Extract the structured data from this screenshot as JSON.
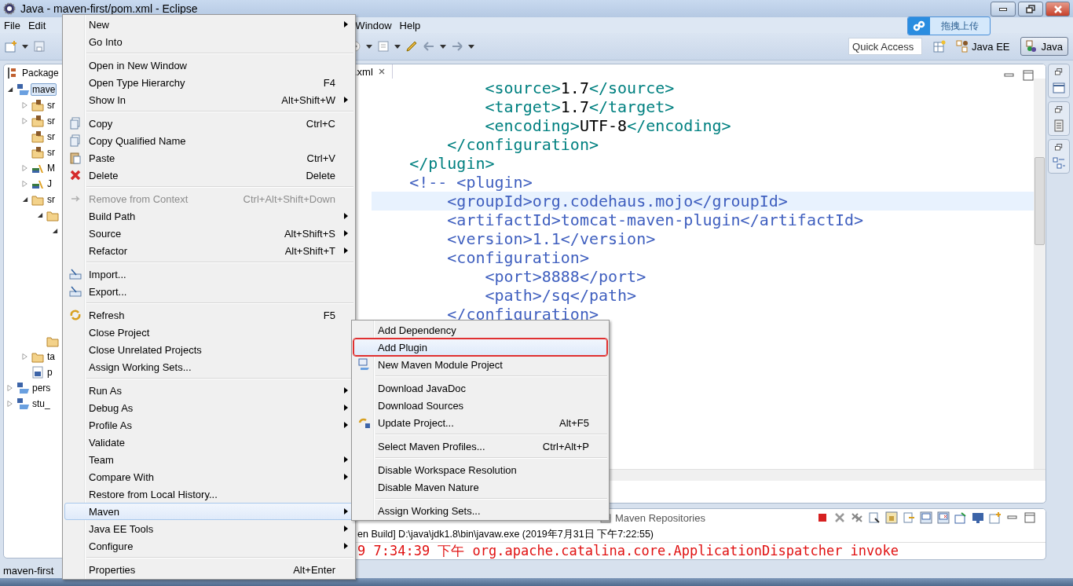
{
  "window": {
    "title": "Java - maven-first/pom.xml - Eclipse"
  },
  "menubar": [
    "File",
    "Edit",
    "Window",
    "Help"
  ],
  "quick_access": {
    "placeholder": "Quick Access"
  },
  "perspectives": [
    {
      "label": "Java EE",
      "selected": false
    },
    {
      "label": "Java",
      "selected": true
    }
  ],
  "upload_button": {
    "label": "拖拽上传"
  },
  "package_explorer": {
    "title": "Package",
    "tree": [
      {
        "label": "mave",
        "kind": "project",
        "expanded": true,
        "selected": true,
        "children": [
          {
            "label": "sr",
            "kind": "package",
            "expanded": false,
            "selected": false
          },
          {
            "label": "sr",
            "kind": "package",
            "expanded": false,
            "selected": false
          },
          {
            "label": "sr",
            "kind": "package",
            "selected": false
          },
          {
            "label": "sr",
            "kind": "package",
            "selected": false
          },
          {
            "label": "M",
            "kind": "library",
            "expanded": false,
            "selected": false
          },
          {
            "label": "J",
            "kind": "library",
            "expanded": false,
            "selected": false
          },
          {
            "label": "sr",
            "kind": "folder",
            "expanded": true,
            "selected": false,
            "children": [
              {
                "kind": "folder",
                "expanded": true,
                "children": [
                  {
                    "expanded": true
                  }
                ]
              },
              {
                "kind": "folder"
              }
            ]
          },
          {
            "label": "ta",
            "kind": "folder",
            "expanded": false,
            "selected": false
          },
          {
            "label": "p",
            "kind": "file",
            "selected": false
          }
        ]
      },
      {
        "label": "pers",
        "kind": "project",
        "expanded": false,
        "selected": false
      },
      {
        "label": "stu_",
        "kind": "project",
        "expanded": false,
        "selected": false
      }
    ]
  },
  "editor": {
    "tab": ".xml",
    "lines": [
      {
        "current": false,
        "segments": [
          {
            "kind": "markup",
            "text": "            <source>"
          },
          {
            "kind": "content",
            "text": "1.7"
          },
          {
            "kind": "markup",
            "text": "</source>"
          }
        ]
      },
      {
        "current": false,
        "segments": [
          {
            "kind": "markup",
            "text": "            <target>"
          },
          {
            "kind": "content",
            "text": "1.7"
          },
          {
            "kind": "markup",
            "text": "</target>"
          }
        ]
      },
      {
        "current": false,
        "segments": [
          {
            "kind": "markup",
            "text": "            <encoding>"
          },
          {
            "kind": "content",
            "text": "UTF-8"
          },
          {
            "kind": "markup",
            "text": "</encoding>"
          }
        ]
      },
      {
        "current": false,
        "segments": [
          {
            "kind": "markup",
            "text": "        </configuration>"
          }
        ]
      },
      {
        "current": false,
        "segments": [
          {
            "kind": "markup",
            "text": "    </plugin>"
          }
        ]
      },
      {
        "current": false,
        "segments": [
          {
            "kind": "comment",
            "text": "    <!-- <plugin>"
          }
        ]
      },
      {
        "current": true,
        "segments": [
          {
            "kind": "comment",
            "text": "        <groupId>org.codehaus.mojo</groupId>"
          }
        ]
      },
      {
        "current": false,
        "segments": [
          {
            "kind": "comment",
            "text": "        <artifactId>tomcat-maven-plugin</artifactId>"
          }
        ]
      },
      {
        "current": false,
        "segments": [
          {
            "kind": "comment",
            "text": "        <version>1.1</version>"
          }
        ]
      },
      {
        "current": false,
        "segments": [
          {
            "kind": "comment",
            "text": "        <configuration>"
          }
        ]
      },
      {
        "current": false,
        "segments": [
          {
            "kind": "comment",
            "text": "            <port>8888</port>"
          }
        ]
      },
      {
        "current": false,
        "segments": [
          {
            "kind": "comment",
            "text": "            <path>/sq</path>"
          }
        ]
      },
      {
        "current": false,
        "segments": [
          {
            "kind": "comment",
            "text": "        </configuration>"
          }
        ]
      }
    ]
  },
  "console": {
    "tab": "Maven Repositories",
    "lines": [
      {
        "kind": "info",
        "text": "en Build] D:\\java\\jdk1.8\\bin\\javaw.exe (2019年7月31日 下午7:22:55)"
      },
      {
        "kind": "error",
        "text": "9 7:34:39 下午 org.apache.catalina.core.ApplicationDispatcher invoke"
      }
    ]
  },
  "status_bar": {
    "text": "maven-first"
  },
  "context_menu": {
    "items": [
      {
        "kind": "item",
        "label": "New",
        "submenu": true
      },
      {
        "kind": "item",
        "label": "Go Into"
      },
      {
        "kind": "separator"
      },
      {
        "kind": "item",
        "label": "Open in New Window"
      },
      {
        "kind": "item",
        "label": "Open Type Hierarchy",
        "shortcut": "F4"
      },
      {
        "kind": "item",
        "label": "Show In",
        "shortcut": "Alt+Shift+W",
        "submenu": true
      },
      {
        "kind": "separator"
      },
      {
        "kind": "item",
        "label": "Copy",
        "shortcut": "Ctrl+C"
      },
      {
        "kind": "item",
        "label": "Copy Qualified Name"
      },
      {
        "kind": "item",
        "label": "Paste",
        "shortcut": "Ctrl+V"
      },
      {
        "kind": "item",
        "label": "Delete",
        "shortcut": "Delete"
      },
      {
        "kind": "separator"
      },
      {
        "kind": "item",
        "label": "Remove from Context",
        "shortcut": "Ctrl+Alt+Shift+Down",
        "disabled": true
      },
      {
        "kind": "item",
        "label": "Build Path",
        "submenu": true
      },
      {
        "kind": "item",
        "label": "Source",
        "shortcut": "Alt+Shift+S",
        "submenu": true
      },
      {
        "kind": "item",
        "label": "Refactor",
        "shortcut": "Alt+Shift+T",
        "submenu": true
      },
      {
        "kind": "separator"
      },
      {
        "kind": "item",
        "label": "Import..."
      },
      {
        "kind": "item",
        "label": "Export..."
      },
      {
        "kind": "separator"
      },
      {
        "kind": "item",
        "label": "Refresh",
        "shortcut": "F5"
      },
      {
        "kind": "item",
        "label": "Close Project"
      },
      {
        "kind": "item",
        "label": "Close Unrelated Projects"
      },
      {
        "kind": "item",
        "label": "Assign Working Sets..."
      },
      {
        "kind": "separator"
      },
      {
        "kind": "item",
        "label": "Run As",
        "submenu": true
      },
      {
        "kind": "item",
        "label": "Debug As",
        "submenu": true
      },
      {
        "kind": "item",
        "label": "Profile As",
        "submenu": true
      },
      {
        "kind": "item",
        "label": "Validate"
      },
      {
        "kind": "item",
        "label": "Team",
        "submenu": true
      },
      {
        "kind": "item",
        "label": "Compare With",
        "submenu": true
      },
      {
        "kind": "item",
        "label": "Restore from Local History..."
      },
      {
        "kind": "item",
        "label": "Maven",
        "submenu": true,
        "selected": true
      },
      {
        "kind": "item",
        "label": "Java EE Tools",
        "submenu": true
      },
      {
        "kind": "item",
        "label": "Configure",
        "submenu": true
      },
      {
        "kind": "separator"
      },
      {
        "kind": "item",
        "label": "Properties",
        "shortcut": "Alt+Enter"
      }
    ]
  },
  "submenu": {
    "items": [
      {
        "kind": "item",
        "label": "Add Dependency",
        "selected": false
      },
      {
        "kind": "item",
        "label": "Add Plugin",
        "selected": true
      },
      {
        "kind": "item",
        "label": "New Maven Module Project",
        "selected": false
      },
      {
        "kind": "separator"
      },
      {
        "kind": "item",
        "label": "Download JavaDoc",
        "selected": false
      },
      {
        "kind": "item",
        "label": "Download Sources",
        "selected": false
      },
      {
        "kind": "item",
        "label": "Update Project...",
        "shortcut": "Alt+F5",
        "selected": false
      },
      {
        "kind": "separator"
      },
      {
        "kind": "item",
        "label": "Select Maven Profiles...",
        "shortcut": "Ctrl+Alt+P",
        "selected": false
      },
      {
        "kind": "separator"
      },
      {
        "kind": "item",
        "label": "Disable Workspace Resolution",
        "selected": false
      },
      {
        "kind": "item",
        "label": "Disable Maven Nature",
        "selected": false
      },
      {
        "kind": "separator"
      },
      {
        "kind": "item",
        "label": "Assign Working Sets...",
        "selected": false
      }
    ]
  }
}
